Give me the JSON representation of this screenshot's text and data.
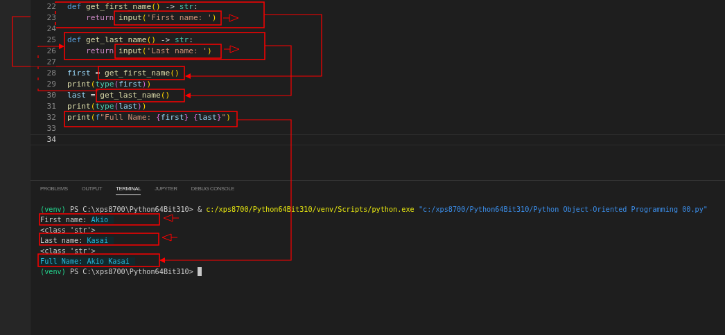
{
  "editor": {
    "lines": [
      {
        "number": "22",
        "active": false,
        "parts": [
          [
            {
              "text": "def ",
              "kind": "kw"
            },
            {
              "text": "get_first_name",
              "kind": "fn"
            },
            {
              "text": "()",
              "kind": "br"
            },
            {
              "text": " -> ",
              "kind": "op"
            },
            {
              "text": "str",
              "kind": "ty"
            },
            {
              "text": ":",
              "kind": "op"
            }
          ]
        ]
      },
      {
        "number": "23",
        "active": false,
        "parts": [
          [
            {
              "text": "    return ",
              "kind": "ctl"
            }
          ],
          [
            {
              "text": "input",
              "kind": "fn"
            },
            {
              "text": "(",
              "kind": "br"
            },
            {
              "text": "'First name: '",
              "kind": "str"
            },
            {
              "text": ")",
              "kind": "br"
            }
          ]
        ]
      },
      {
        "number": "24",
        "active": false
      },
      {
        "number": "25",
        "active": false,
        "parts": [
          [
            {
              "text": "def ",
              "kind": "kw"
            },
            {
              "text": "get_last_name",
              "kind": "fn"
            },
            {
              "text": "()",
              "kind": "br"
            },
            {
              "text": " -> ",
              "kind": "op"
            },
            {
              "text": "str",
              "kind": "ty"
            },
            {
              "text": ":",
              "kind": "op"
            }
          ]
        ]
      },
      {
        "number": "26",
        "active": false,
        "parts": [
          [
            {
              "text": "    return ",
              "kind": "ctl"
            }
          ],
          [
            {
              "text": "input",
              "kind": "fn"
            },
            {
              "text": "(",
              "kind": "br"
            },
            {
              "text": "'Last name: '",
              "kind": "str"
            },
            {
              "text": ")",
              "kind": "br"
            }
          ]
        ]
      },
      {
        "number": "27",
        "active": false
      },
      {
        "number": "28",
        "active": false,
        "parts": [
          [
            {
              "text": "first",
              "kind": "var"
            },
            {
              "text": " = ",
              "kind": "op"
            }
          ],
          [
            {
              "text": "get_first_name",
              "kind": "fn"
            },
            {
              "text": "()",
              "kind": "br"
            }
          ]
        ]
      },
      {
        "number": "29",
        "active": false,
        "parts": [
          [
            {
              "text": "print",
              "kind": "fn"
            },
            {
              "text": "(",
              "kind": "br"
            },
            {
              "text": "type",
              "kind": "ty"
            },
            {
              "text": "(",
              "kind": "br2"
            },
            {
              "text": "first",
              "kind": "var"
            },
            {
              "text": ")",
              "kind": "br2"
            },
            {
              "text": ")",
              "kind": "br"
            }
          ]
        ]
      },
      {
        "number": "30",
        "active": false,
        "parts": [
          [
            {
              "text": "last",
              "kind": "var"
            },
            {
              "text": " = ",
              "kind": "op"
            }
          ],
          [
            {
              "text": "get_last_name",
              "kind": "fn"
            },
            {
              "text": "()",
              "kind": "br"
            }
          ]
        ]
      },
      {
        "number": "31",
        "active": false,
        "parts": [
          [
            {
              "text": "print",
              "kind": "fn"
            },
            {
              "text": "(",
              "kind": "br"
            },
            {
              "text": "type",
              "kind": "ty"
            },
            {
              "text": "(",
              "kind": "br2"
            },
            {
              "text": "last",
              "kind": "var"
            },
            {
              "text": ")",
              "kind": "br2"
            },
            {
              "text": ")",
              "kind": "br"
            }
          ]
        ]
      },
      {
        "number": "32",
        "active": false,
        "parts": [
          [
            {
              "text": "print",
              "kind": "fn"
            },
            {
              "text": "(",
              "kind": "br"
            },
            {
              "text": "f",
              "kind": "kw"
            },
            {
              "text": "\"Full Name: ",
              "kind": "str"
            },
            {
              "text": "{",
              "kind": "br2"
            },
            {
              "text": "first",
              "kind": "var"
            },
            {
              "text": "}",
              "kind": "br2"
            },
            {
              "text": " {",
              "kind": "br2"
            },
            {
              "text": "last",
              "kind": "var"
            },
            {
              "text": "}",
              "kind": "br2"
            },
            {
              "text": "\"",
              "kind": "str"
            },
            {
              "text": ")",
              "kind": "br"
            }
          ]
        ]
      },
      {
        "number": "33",
        "active": false
      },
      {
        "number": "34",
        "active": true
      }
    ]
  },
  "panel": {
    "tabs": [
      {
        "label": "PROBLEMS",
        "selected": false
      },
      {
        "label": "OUTPUT",
        "selected": false
      },
      {
        "label": "TERMINAL",
        "selected": true
      },
      {
        "label": "JUPYTER",
        "selected": false
      },
      {
        "label": "DEBUG CONSOLE",
        "selected": false
      }
    ],
    "terminal": [
      {
        "cursor": false,
        "segments": [
          {
            "text": "(venv)",
            "kind": "env"
          },
          {
            "text": " PS C:\\xps8700\\Python64Bit310> & ",
            "kind": "plain"
          },
          {
            "text": "c:/xps8700/Python64Bit310/venv/Scripts/python.exe",
            "kind": "cmd"
          },
          {
            "text": " \"c:/xps8700/Python64Bit310/Python Object-Oriented Programming 00.py\"",
            "kind": "arg"
          }
        ]
      },
      {
        "cursor": false,
        "segments": [
          {
            "text": "First name: ",
            "kind": "plain"
          },
          {
            "text": "Akio",
            "kind": "input"
          }
        ]
      },
      {
        "cursor": false,
        "segments": [
          {
            "text": "<class 'str'>",
            "kind": "plain"
          }
        ]
      },
      {
        "cursor": false,
        "segments": [
          {
            "text": "Last name: ",
            "kind": "plain"
          },
          {
            "text": "Kasai",
            "kind": "input"
          }
        ]
      },
      {
        "cursor": false,
        "segments": [
          {
            "text": "<class 'str'>",
            "kind": "plain"
          }
        ]
      },
      {
        "cursor": false,
        "segments": [
          {
            "text": "Full Name: Akio Kasai",
            "kind": "input"
          }
        ]
      },
      {
        "cursor": true,
        "segments": [
          {
            "text": "(venv)",
            "kind": "env"
          },
          {
            "text": " PS C:\\xps8700\\Python64Bit310> ",
            "kind": "plain"
          }
        ]
      }
    ]
  }
}
